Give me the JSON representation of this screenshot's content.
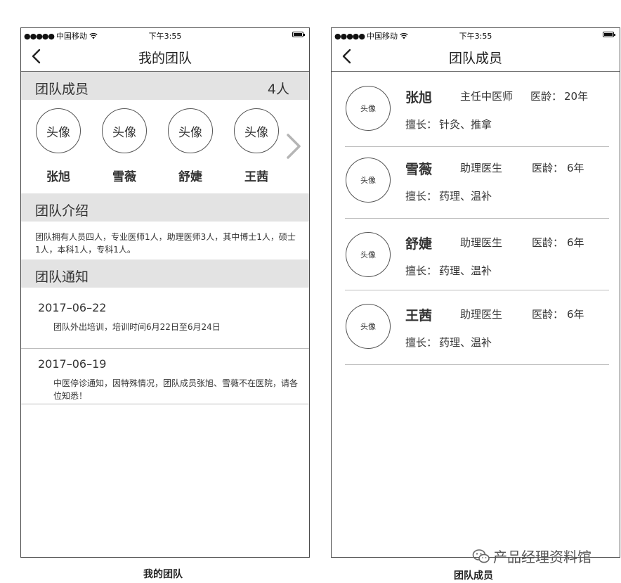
{
  "status_bar": {
    "dots": "●●●●●",
    "carrier": "中国移动",
    "time": "下午3:55"
  },
  "left_screen": {
    "title": "我的团队",
    "members_section": {
      "label": "团队成员",
      "count": "4人"
    },
    "avatar_placeholder": "头像",
    "members": [
      "张旭",
      "雪薇",
      "舒婕",
      "王茜"
    ],
    "intro_section": {
      "label": "团队介绍",
      "text": "团队拥有人员四人，专业医师1人，助理医师3人，其中博士1人，硕士1人，本科1人，专科1人。"
    },
    "notice_section": {
      "label": "团队通知",
      "notices": [
        {
          "date": "2017–06–22",
          "text": "团队外出培训，培训时间6月22日至6月24日"
        },
        {
          "date": "2017–06–19",
          "text": "中医停诊通知，因特殊情况，团队成员张旭、雪薇不在医院，请各位知悉！"
        }
      ]
    },
    "caption": "我的团队"
  },
  "right_screen": {
    "title": "团队成员",
    "avatar_placeholder": "头像",
    "years_label": "医龄：",
    "skill_label": "擅长：",
    "members": [
      {
        "name": "张旭",
        "title": "主任中医师",
        "years": "20年",
        "skill": "针灸、推拿"
      },
      {
        "name": "雪薇",
        "title": "助理医生",
        "years": "6年",
        "skill": "药理、温补"
      },
      {
        "name": "舒婕",
        "title": "助理医生",
        "years": "6年",
        "skill": "药理、温补"
      },
      {
        "name": "王茜",
        "title": "助理医生",
        "years": "6年",
        "skill": "药理、温补"
      }
    ],
    "caption": "团队成员"
  },
  "watermark": {
    "text": "产品经理资料馆",
    "icon": "wechat-icon"
  },
  "colors": {
    "section_bg": "#e3e3e3",
    "border": "#4a4a4a",
    "divider": "#bdbdbd",
    "chevron": "#b5b5b5"
  }
}
